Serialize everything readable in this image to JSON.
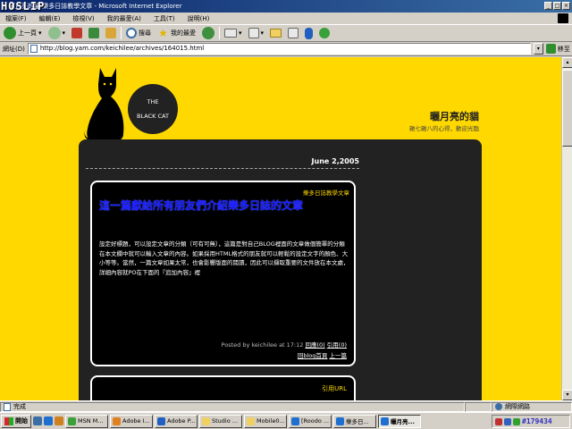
{
  "window": {
    "title": "曬月亮的貓 樂多日誌教學文章 - Microsoft Internet Explorer",
    "watermark": "HOSLIP"
  },
  "menu": [
    "檔案(F)",
    "編輯(E)",
    "檢視(V)",
    "我的最愛(A)",
    "工具(T)",
    "說明(H)"
  ],
  "toolbar": {
    "back_label": "上一頁",
    "search_label": "搜尋",
    "favorites_label": "我的最愛"
  },
  "address": {
    "label": "網址(D)",
    "url": "http://blog.yam.com/keichilee/archives/164015.html",
    "go_label": "移至"
  },
  "blog": {
    "logo_line1": "THE",
    "logo_line2": "BLACK CAT",
    "title": "曬月亮的貓",
    "subtitle": "雜七雜八的心得，歡迎光臨",
    "date": "June 2,2005",
    "post": {
      "category": "樂多日誌教學文章",
      "title": "這一篇獻給所有朋友們介紹樂多日誌的文章",
      "body": [
        "設定好標題，可以設定文章的分類（可有可無），這篇是對自己BLOG裡面的文章做個簡單的分類",
        "在本文欄中就可以輸入文章的內容。如果採用HTML格式的朋友就可以輕鬆的設定文字的顏色、大",
        "小等等。當然，一篇文章如果太常，也會影響版面的閱讀，因此可以擷取重要的文件放在本文處，",
        "詳細內容就PO在下面的『追加內容』裡"
      ],
      "meta_prefix": "Posted by keichilee at 17:12",
      "reply_link": "回應(0)",
      "trackback_link": "引用(0)",
      "home_link": "回blog首頁",
      "prev_link": "上一篇"
    },
    "trackback_title": "引用URL"
  },
  "status": {
    "left": "完成",
    "zone": "網際網路"
  },
  "taskbar": {
    "start_label": "開始",
    "tasks": [
      "MSN M...",
      "Adobe I...",
      "Adobe P...",
      "Studio ...",
      "Mobile0...",
      "[Roodo ...",
      "樂多日...",
      "曬月亮..."
    ],
    "clock": "#179434"
  },
  "colors": {
    "page_bg": "#ffd800",
    "panel_bg": "#222222",
    "post_title": "#1a1aff",
    "category": "#ffd800"
  }
}
